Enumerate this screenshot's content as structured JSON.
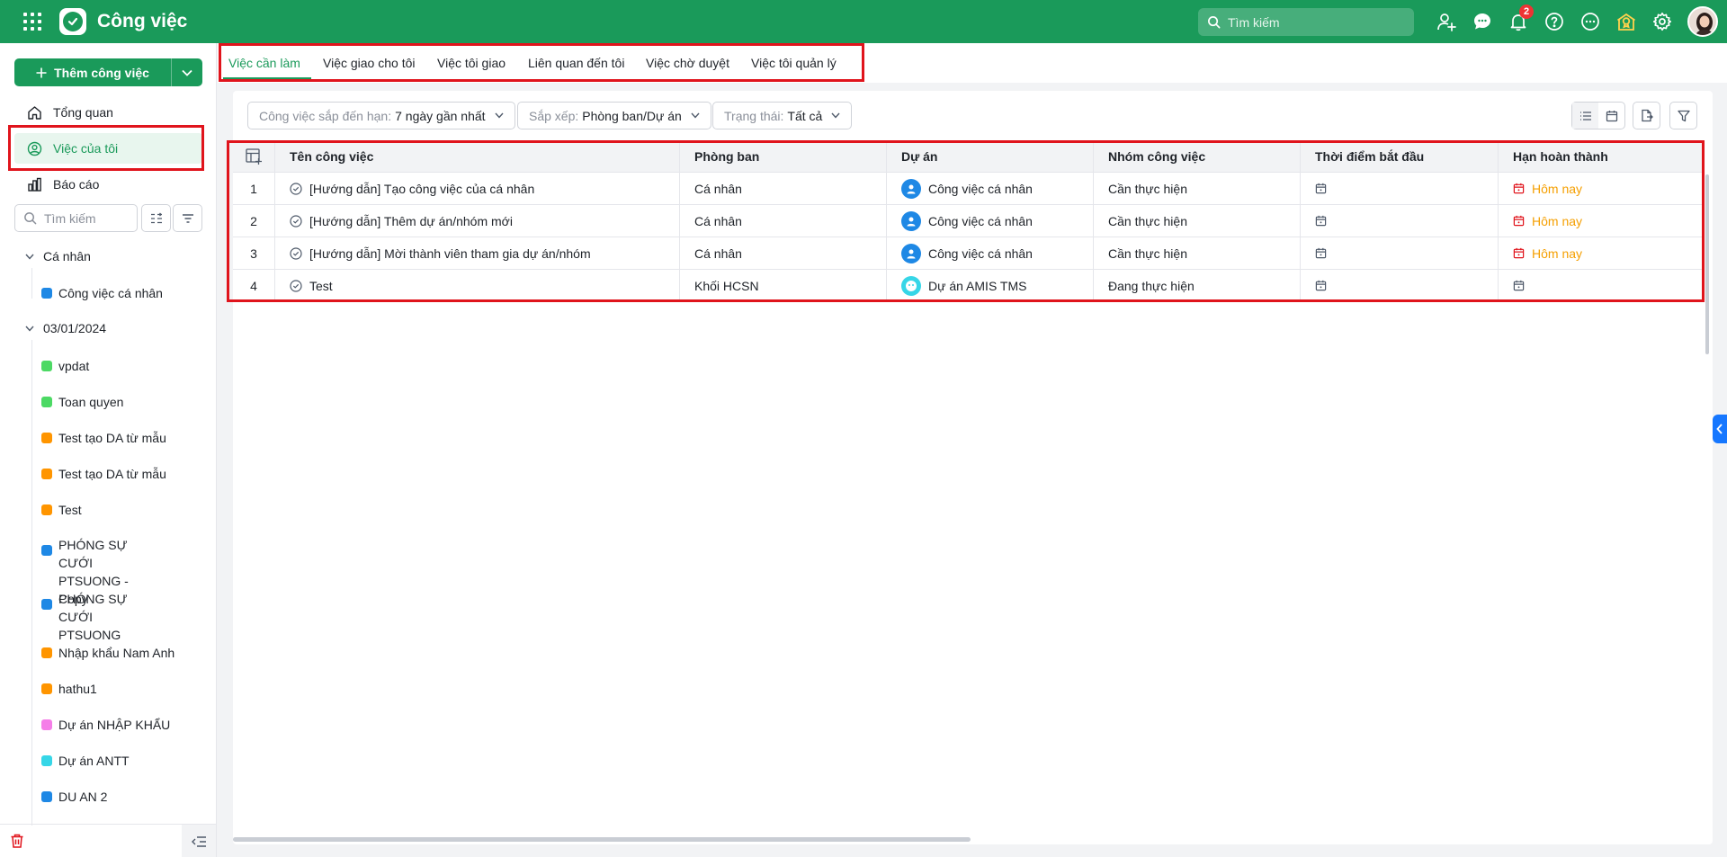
{
  "app": {
    "title": "Công việc",
    "search_placeholder": "Tìm kiếm",
    "notification_count": "2"
  },
  "icons": [
    "apps-grid-icon",
    "app-logo-check-icon",
    "search-icon",
    "add-user-icon",
    "chat-icon",
    "bell-icon",
    "help-icon",
    "more-icon",
    "award-icon",
    "gear-icon"
  ],
  "sidebar": {
    "add_button": "Thêm công việc",
    "nav": [
      {
        "label": "Tổng quan",
        "icon": "home-icon"
      },
      {
        "label": "Việc của tôi",
        "icon": "user-circle-icon"
      },
      {
        "label": "Báo cáo",
        "icon": "bar-chart-icon"
      }
    ],
    "search_placeholder": "Tìm kiếm",
    "groups": [
      {
        "label": "Cá nhân",
        "items": [
          {
            "label": "Công việc cá nhân",
            "color": "#1e88e5"
          }
        ]
      },
      {
        "label": "03/01/2024",
        "items": [
          {
            "label": "vpdat",
            "color": "#4cd964"
          },
          {
            "label": "Toan quyen",
            "color": "#4cd964"
          },
          {
            "label": "Test tạo DA từ mẫu",
            "color": "#ff9500"
          },
          {
            "label": "Test tạo DA từ mẫu",
            "color": "#ff9500"
          },
          {
            "label": "Test",
            "color": "#ff9500"
          },
          {
            "label": "PHÓNG SỰ CƯỚI PTSUONG - Copy",
            "color": "#1e88e5"
          },
          {
            "label": "PHÓNG SỰ CƯỚI PTSUONG",
            "color": "#1e88e5"
          },
          {
            "label": "Nhập khẩu Nam Anh",
            "color": "#ff9500"
          },
          {
            "label": "hathu1",
            "color": "#ff9500"
          },
          {
            "label": "Dự án NHẬP KHẨU",
            "color": "#f57ee8"
          },
          {
            "label": "Dự án ANTT",
            "color": "#36d6e7"
          },
          {
            "label": "DU AN 2",
            "color": "#1e88e5"
          }
        ]
      }
    ]
  },
  "tabs": [
    "Việc cần làm",
    "Việc giao cho tôi",
    "Việc tôi giao",
    "Liên quan đến tôi",
    "Việc chờ duyệt",
    "Việc tôi quản lý"
  ],
  "filters": [
    {
      "label": "Công việc sắp đến hạn:",
      "value": "7 ngày gần nhất"
    },
    {
      "label": "Sắp xếp:",
      "value": "Phòng ban/Dự án"
    },
    {
      "label": "Trạng thái:",
      "value": "Tất cả"
    }
  ],
  "table": {
    "columns": [
      "Tên công việc",
      "Phòng ban",
      "Dự án",
      "Nhóm công việc",
      "Thời điểm bắt đầu",
      "Hạn hoàn thành"
    ],
    "rows": [
      {
        "no": "1",
        "name": "[Hướng dẫn] Tạo công việc của cá nhân",
        "dept": "Cá nhân",
        "project": "Công việc cá nhân",
        "group": "Cần thực hiện",
        "start": "",
        "due": "Hôm nay"
      },
      {
        "no": "2",
        "name": "[Hướng dẫn] Thêm dự án/nhóm mới",
        "dept": "Cá nhân",
        "project": "Công việc cá nhân",
        "group": "Cần thực hiện",
        "start": "",
        "due": "Hôm nay"
      },
      {
        "no": "3",
        "name": "[Hướng dẫn] Mời thành viên tham gia dự án/nhóm",
        "dept": "Cá nhân",
        "project": "Công việc cá nhân",
        "group": "Cần thực hiện",
        "start": "",
        "due": "Hôm nay"
      },
      {
        "no": "4",
        "name": "Test",
        "dept": "Khối HCSN",
        "project": "Dự án AMIS TMS",
        "group": "Đang thực hiện",
        "start": "",
        "due": ""
      }
    ]
  },
  "colors": {
    "brand": "#1a9a5a",
    "highlight": "#e0141c",
    "due_today": "#f59f00",
    "project_personal": "#1e88e5",
    "project_amis": "#36d6e7"
  }
}
